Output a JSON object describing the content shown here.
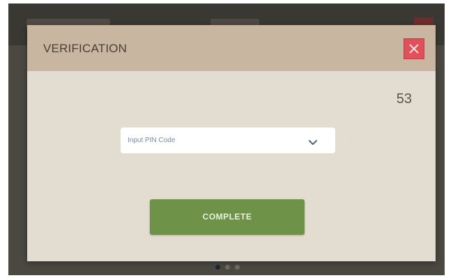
{
  "modal": {
    "title": "VERIFICATION",
    "countdown": "53",
    "pin_select": {
      "placeholder": "Input PIN Code"
    },
    "complete_label": "COMPLETE"
  },
  "colors": {
    "header_bg": "#c8b6a0",
    "modal_bg": "#e3dcd0",
    "close_button": "#e0505a",
    "complete_button": "#6e9248",
    "backdrop": "#4a4841"
  },
  "icons": {
    "close": "close-icon",
    "dropdown": "chevron-down-icon"
  },
  "pager": {
    "pages": 3,
    "active_index": 0
  }
}
